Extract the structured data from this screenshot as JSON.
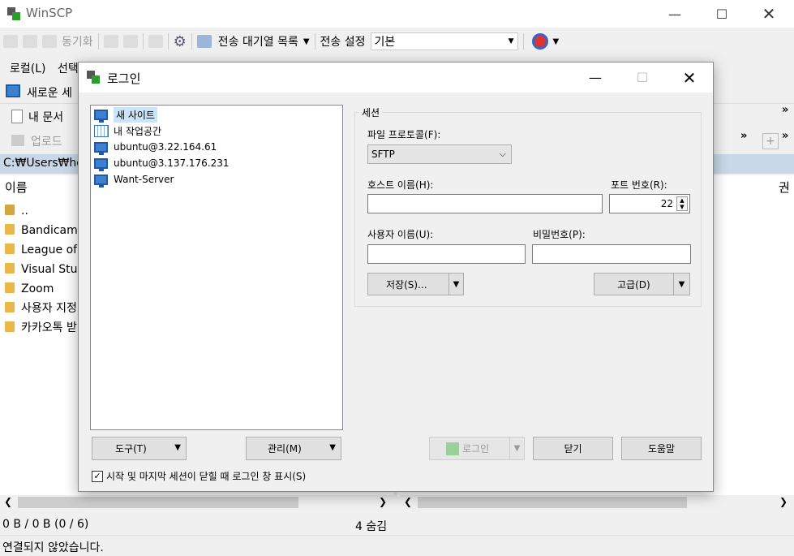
{
  "app": {
    "title": "WinSCP"
  },
  "toolbar": {
    "sync_label": "동기화",
    "queue_label": "전송 대기열 목록",
    "transfer_settings_label": "전송 설정",
    "transfer_preset": "기본"
  },
  "local_panel": {
    "menu_local": "로컬(L)",
    "menu_select": "선택",
    "new_session_label": "새로운 세",
    "my_docs_label": "내 문서",
    "upload_label": "업로드",
    "path": "C:₩Users₩hor",
    "col_name": "이름",
    "right_col": "권",
    "items": [
      "..",
      "Bandicam",
      "League of",
      "Visual Stu",
      "Zoom",
      "사용자 지정",
      "카카오톡 받"
    ]
  },
  "status": {
    "size": "0 B / 0 B (0 / 6)",
    "hidden": "4 숨김",
    "connection": "연결되지 않았습니다."
  },
  "dialog": {
    "title": "로그인",
    "sites": [
      {
        "label": "새 사이트",
        "icon": "new-site-icon"
      },
      {
        "label": "내 작업공간",
        "icon": "workspace-icon"
      },
      {
        "label": "ubuntu@3.22.164.61",
        "icon": "computer-icon"
      },
      {
        "label": "ubuntu@3.137.176.231",
        "icon": "computer-icon"
      },
      {
        "label": "Want-Server",
        "icon": "computer-icon"
      }
    ],
    "session_group": "세션",
    "protocol_label": "파일 프로토콜(F):",
    "protocol_value": "SFTP",
    "host_label": "호스트 이름(H):",
    "host_value": "",
    "port_label": "포트 번호(R):",
    "port_value": "22",
    "user_label": "사용자 이름(U):",
    "user_value": "",
    "password_label": "비밀번호(P):",
    "password_value": "",
    "save_button": "저장(S)...",
    "advanced_button": "고급(D)",
    "tools_button": "도구(T)",
    "manage_button": "관리(M)",
    "login_button": "로그인",
    "close_button": "닫기",
    "help_button": "도움말",
    "show_on_startup": "시작 및 마지막 세션이 닫힐 때 로그인 창 표시(S)",
    "show_on_startup_checked": true
  }
}
